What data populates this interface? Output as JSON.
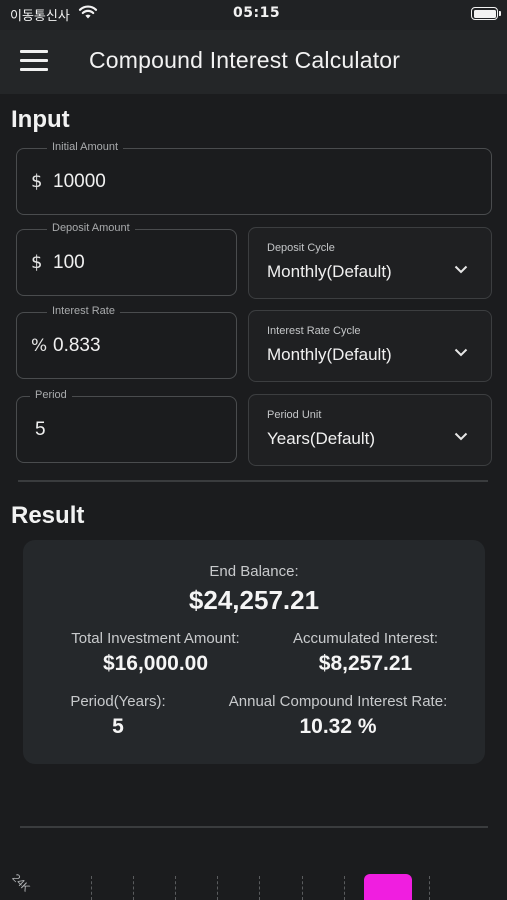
{
  "status_bar": {
    "carrier": "이동통신사",
    "time": "05:15"
  },
  "app_bar": {
    "title": "Compound Interest Calculator",
    "menu_icon": "hamburger-menu-icon"
  },
  "input": {
    "title": "Input",
    "initial_amount": {
      "label": "Initial Amount",
      "prefix": "$",
      "value": "10000"
    },
    "deposit_amount": {
      "label": "Deposit Amount",
      "prefix": "$",
      "value": "100"
    },
    "deposit_cycle": {
      "label": "Deposit Cycle",
      "value": "Monthly(Default)"
    },
    "interest_rate": {
      "label": "Interest Rate",
      "prefix": "%",
      "value": "0.833"
    },
    "interest_rate_cycle": {
      "label": "Interest Rate Cycle",
      "value": "Monthly(Default)"
    },
    "period": {
      "label": "Period",
      "value": "5"
    },
    "period_unit": {
      "label": "Period Unit",
      "value": "Years(Default)"
    }
  },
  "result": {
    "title": "Result",
    "end_balance_label": "End Balance:",
    "end_balance_value": "$24,257.21",
    "total_investment_label": "Total Investment Amount:",
    "total_investment_value": "$16,000.00",
    "accumulated_interest_label": "Accumulated Interest:",
    "accumulated_interest_value": "$8,257.21",
    "period_label": "Period(Years):",
    "period_value": "5",
    "annual_rate_label": "Annual Compound Interest Rate:",
    "annual_rate_value": "10.32 %"
  },
  "chart": {
    "y_tick": "24K",
    "bar_color": "#f01ee0"
  }
}
